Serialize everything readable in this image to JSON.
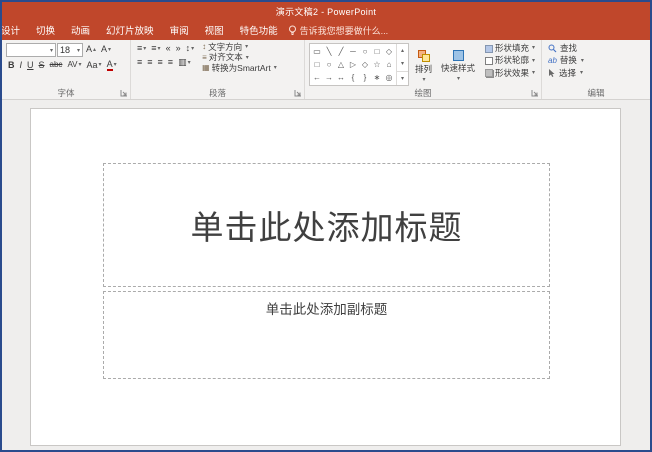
{
  "colors": {
    "accent": "#C0472B",
    "window_border": "#2A4B8D"
  },
  "window": {
    "title": "演示文稿2 - PowerPoint"
  },
  "tabs": {
    "items": [
      "设计",
      "切换",
      "动画",
      "幻灯片放映",
      "审阅",
      "视图",
      "特色功能"
    ],
    "tell_me": "告诉我您想要做什么..."
  },
  "ribbon": {
    "font": {
      "label": "字体",
      "size_value": "18",
      "bold": "B",
      "italic": "I",
      "underline": "U",
      "strike": "S",
      "clear": "abc",
      "spacing": "AV",
      "case_btn": "Aa",
      "color": "A",
      "grow": "A",
      "shrink": "A"
    },
    "paragraph": {
      "label": "段落",
      "text_direction": "文字方向",
      "align_text": "对齐文本",
      "smartart": "转换为SmartArt"
    },
    "drawing": {
      "label": "绘图",
      "arrange": "排列",
      "quick_styles": "快速样式",
      "shape_fill": "形状填充",
      "shape_outline": "形状轮廓",
      "shape_effects": "形状效果",
      "gallery": [
        [
          "▭",
          "╲",
          "╱",
          "─",
          "○",
          "□",
          "◇"
        ],
        [
          "□",
          "○",
          "△",
          "▷",
          "◇",
          "☆",
          "⌂"
        ],
        [
          "←",
          "→",
          "↔",
          "{",
          "}",
          "∗",
          "◎"
        ]
      ]
    },
    "editing": {
      "label": "编辑",
      "find": "查找",
      "replace": "替换",
      "select": "选择"
    }
  },
  "icons": {
    "caret": "▾",
    "scroll_up": "▴",
    "scroll_down": "▾",
    "gallery_more": "▾",
    "bullets": "≡",
    "numbering": "≡",
    "indent_less": "«",
    "indent_more": "»",
    "line_spacing": "↕",
    "align_left": "≡",
    "align_center": "≡",
    "align_right": "≡",
    "justify": "≡",
    "columns": "▥",
    "text_direction": "↕",
    "align_text_ic": "≡",
    "smartart_ic": "▦",
    "replace_ab": "ab"
  },
  "slide": {
    "title_placeholder": "单击此处添加标题",
    "subtitle_placeholder": "单击此处添加副标题"
  }
}
